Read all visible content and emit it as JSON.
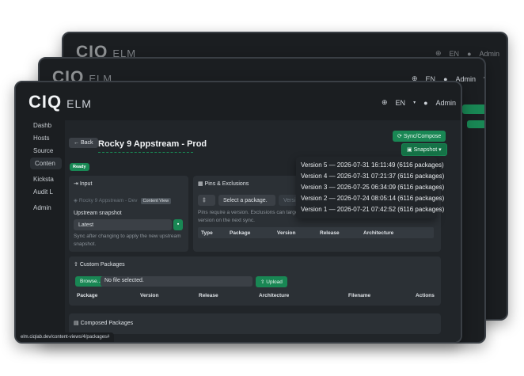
{
  "logo": {
    "mark": "CIQ",
    "product": "ELM"
  },
  "header": {
    "lang": "EN",
    "user": "Admin"
  },
  "sidebar": {
    "items": [
      "Dashb",
      "Hosts",
      "Source",
      "Conten",
      "Kicksta",
      "Audit L",
      "Admin"
    ]
  },
  "page": {
    "back_label": "Back",
    "title": "Rocky 9 Appstream - Prod",
    "status": "Ready",
    "sync_label": "Sync/Compose",
    "snapshot_label": "Snapshot"
  },
  "snapshot_menu": {
    "items": [
      "Version 5 — 2026-07-31 16:11:49 (6116 packages)",
      "Version 4 — 2026-07-31 07:21:37 (6116 packages)",
      "Version 3 — 2026-07-25 06:34:09 (6116 packages)",
      "Version 2 — 2026-07-24 08:05:14 (6116 packages)",
      "Version 1 — 2026-07-21 07:42:52 (6116 packages)"
    ]
  },
  "input_card": {
    "title": "Input",
    "source": "Rocky 9 Appstream - Dev",
    "source_tag": "Content View",
    "upstream_label": "Upstream snapshot",
    "upstream_value": "Latest",
    "help_line1": "Sync after changing to apply the new upstream",
    "help_line2": "snapshot."
  },
  "pins_card": {
    "title": "Pins & Exclusions",
    "type_value": "‡",
    "package_placeholder": "Select a package.",
    "version_placeholder": "Versi",
    "help_line1": "Pins require a version. Exclusions can target a v",
    "help_line2": "version on the next sync.",
    "columns": [
      "Type",
      "Package",
      "Version",
      "Release",
      "Architecture"
    ]
  },
  "custom_card": {
    "title": "Custom Packages",
    "browse_label": "Browse...",
    "file_text": "No file selected.",
    "upload_label": "Upload",
    "columns": [
      "Package",
      "Version",
      "Release",
      "Architecture",
      "Filename",
      "Actions"
    ]
  },
  "composed_card": {
    "title": "Composed Packages"
  },
  "status_url": "elm.ciqlab.dev/content-views/4/packages#"
}
